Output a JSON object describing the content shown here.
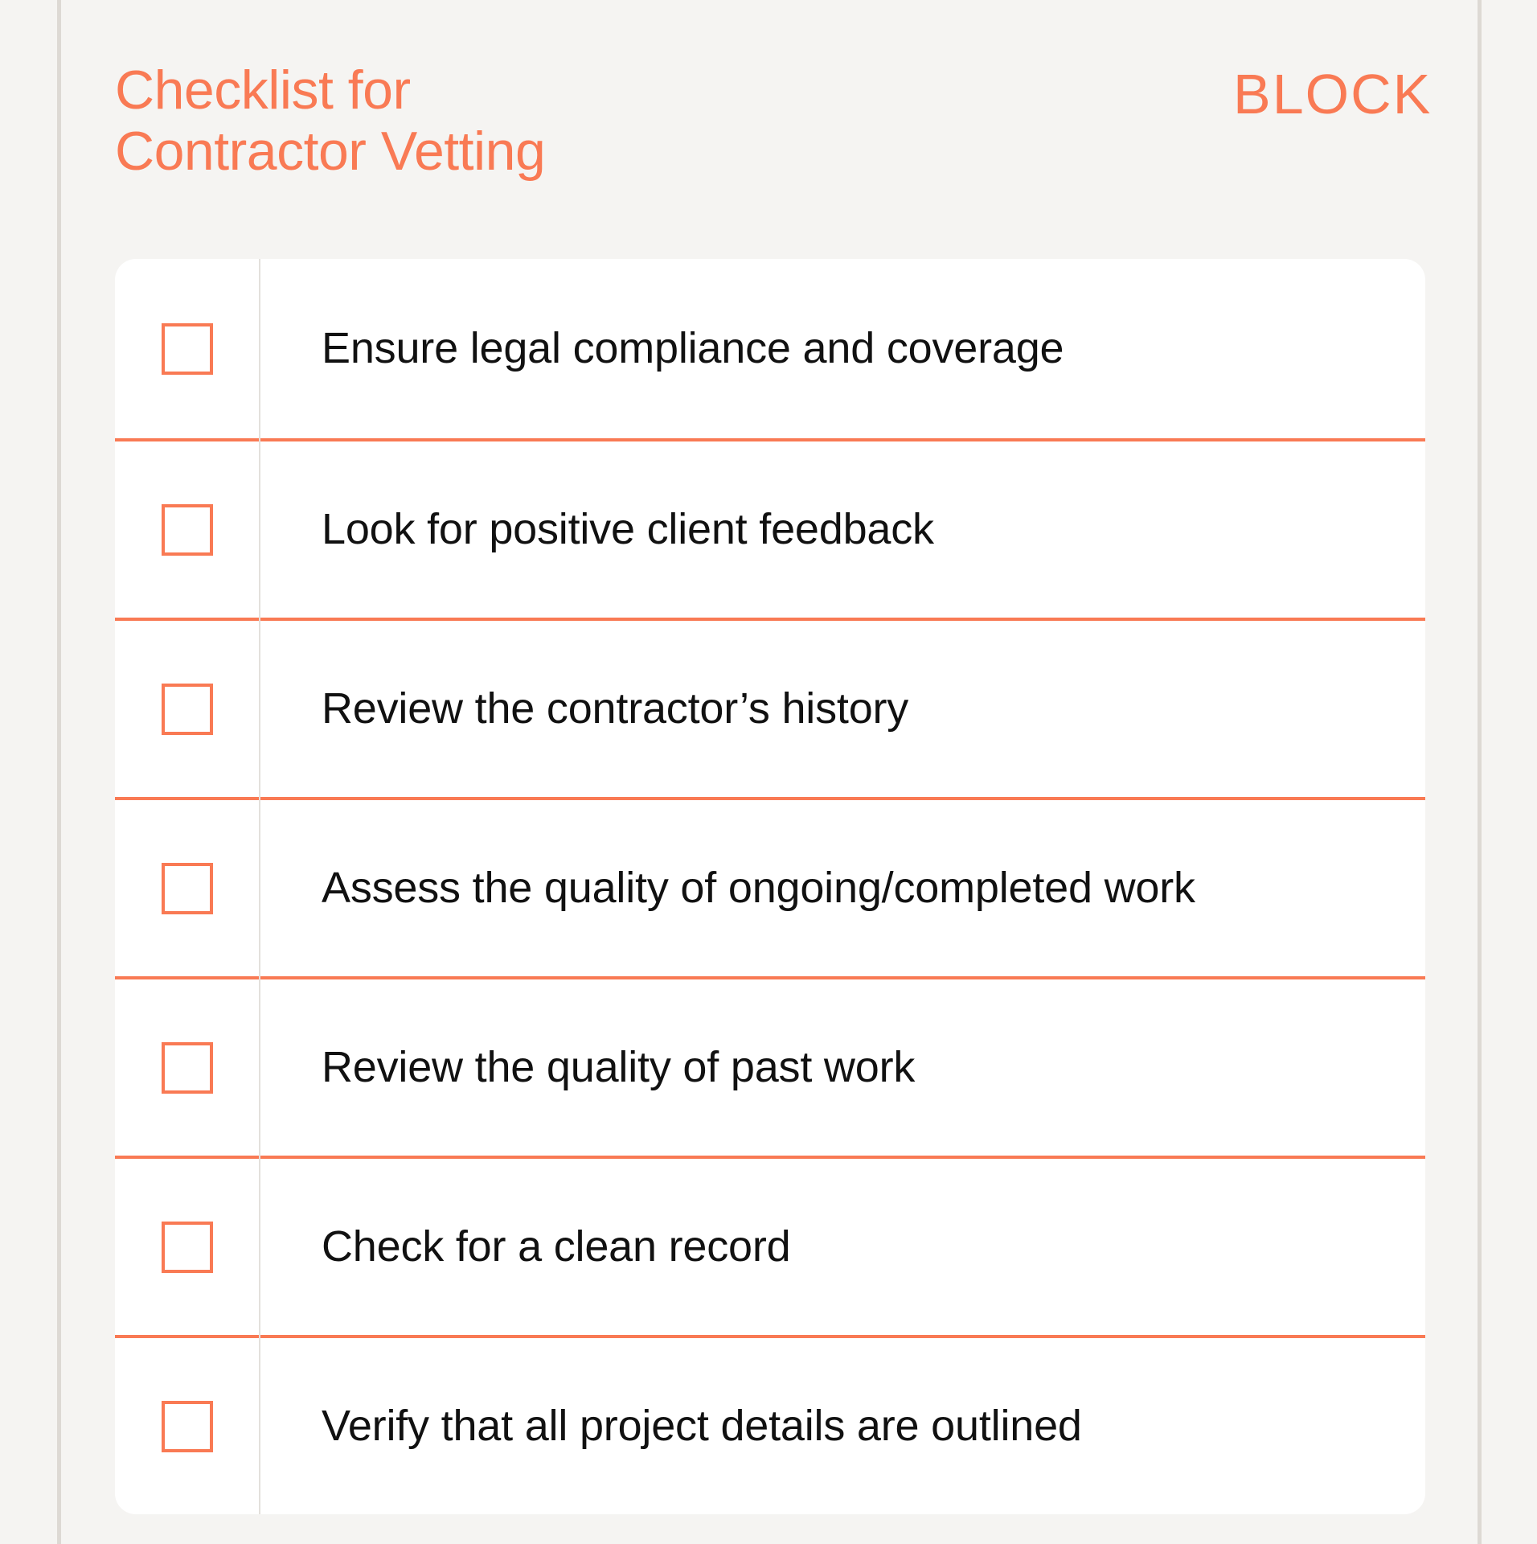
{
  "theme": {
    "page_background": "#f5f4f2",
    "accent": "#f97a54",
    "card_background": "#ffffff",
    "text": "#111111",
    "rule": "#e3e0dc"
  },
  "header": {
    "title": "Checklist for\nContractor Vetting",
    "brand": "BLOCK"
  },
  "checklist": {
    "items": [
      {
        "label": "Ensure legal compliance and coverage",
        "checked": false
      },
      {
        "label": "Look for positive client feedback",
        "checked": false
      },
      {
        "label": "Review the contractor’s history",
        "checked": false
      },
      {
        "label": "Assess the quality of ongoing/completed work",
        "checked": false
      },
      {
        "label": "Review the quality of past work",
        "checked": false
      },
      {
        "label": "Check for a clean record",
        "checked": false
      },
      {
        "label": "Verify that all project details are outlined",
        "checked": false
      }
    ]
  }
}
